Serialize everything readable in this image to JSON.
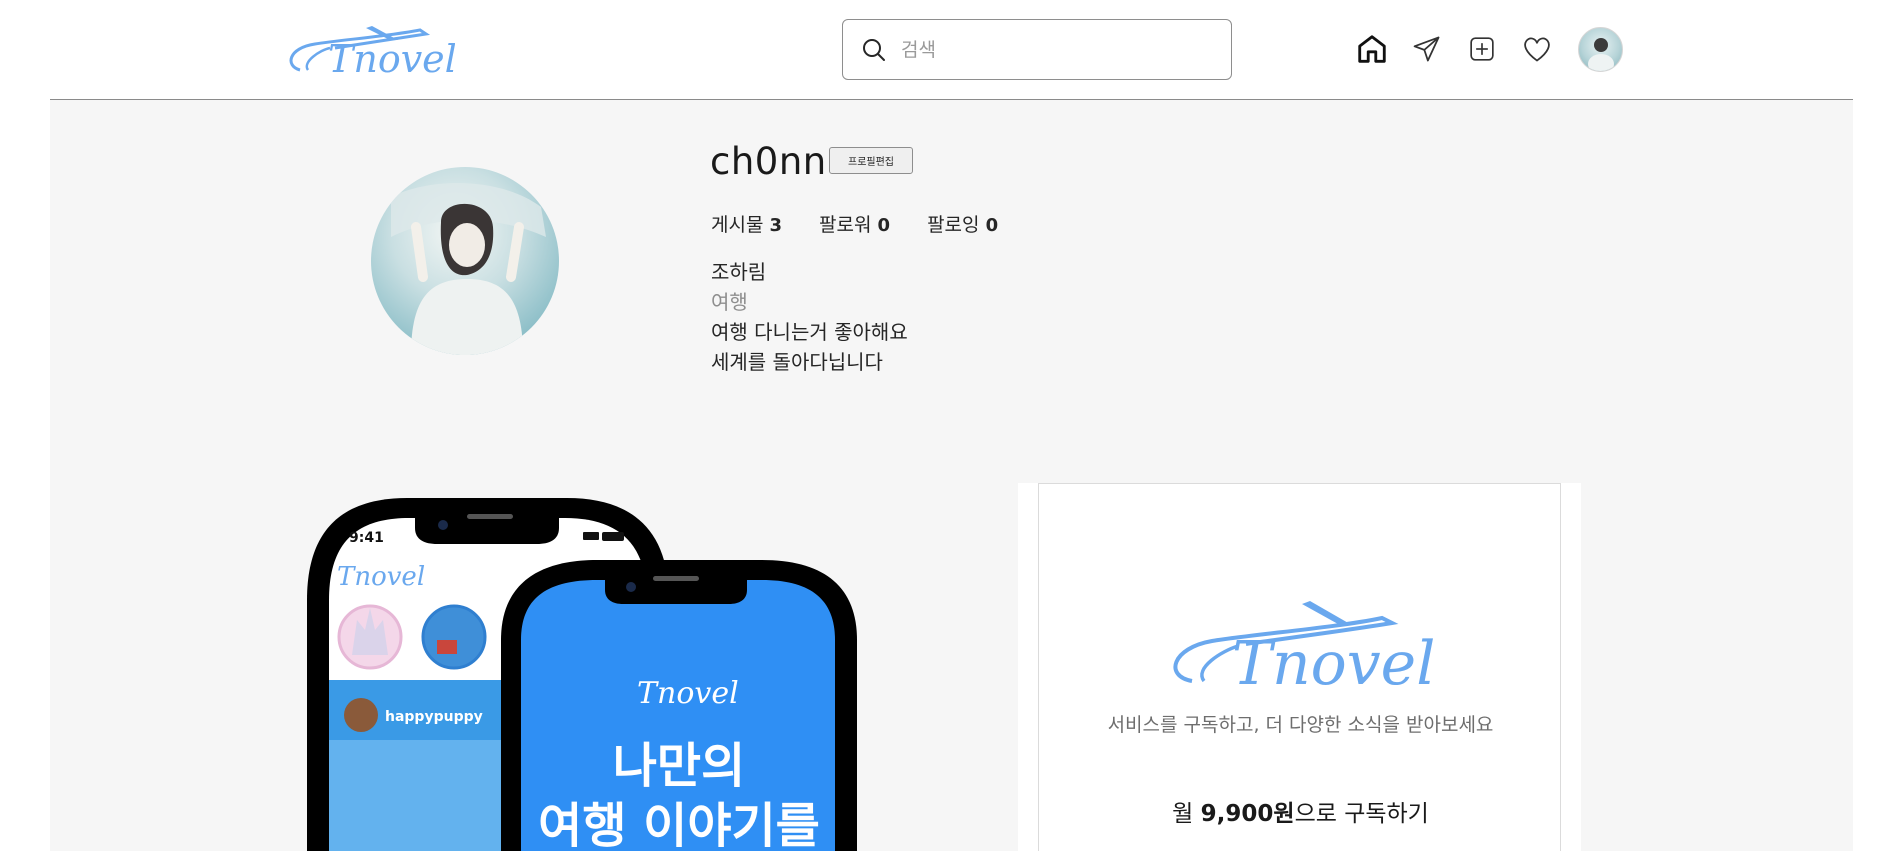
{
  "header": {
    "logo_text": "Tnovel",
    "search": {
      "placeholder": "검색",
      "value": ""
    },
    "nav_icons": [
      "home-icon",
      "send-icon",
      "add-post-icon",
      "heart-icon",
      "avatar"
    ]
  },
  "profile": {
    "username": "ch0nn",
    "edit_label": "프로필편집",
    "stats": {
      "posts_label": "게시물",
      "posts": "3",
      "followers_label": "팔로워",
      "followers": "0",
      "following_label": "팔로잉",
      "following": "0"
    },
    "name": "조하림",
    "category": "여행",
    "bio_lines": [
      "여행 다니는거 좋아해요",
      "세계를 돌아다닙니다"
    ]
  },
  "promo_phone": {
    "time": "9:41",
    "logo_text": "Tnovel",
    "story_user": "happypuppy",
    "headline_line1": "나만의",
    "headline_line2": "여행 이야기를"
  },
  "subscription": {
    "logo_text": "Tnovel",
    "tagline": "서비스를 구독하고, 더 다양한 소식을 받아보세요",
    "button_prefix": "월 ",
    "button_price": "9,900원",
    "button_suffix": "으로 구독하기"
  },
  "colors": {
    "brand_blue": "#6aa8ee",
    "phone_blue": "#2f8ff4",
    "background": "#f6f6f6"
  }
}
